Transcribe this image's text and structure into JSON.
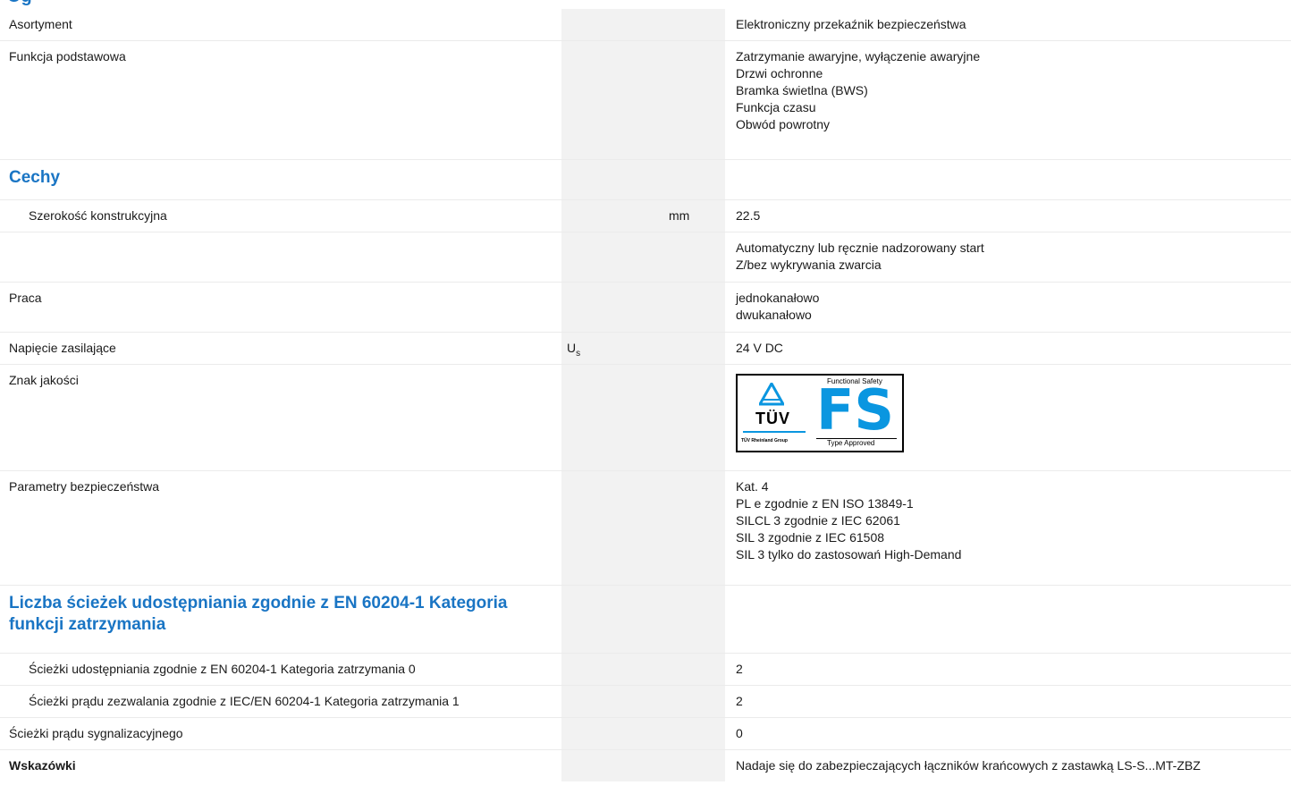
{
  "clipped_heading": "Og",
  "rows": {
    "asortyment": {
      "label": "Asortyment",
      "value": "Elektroniczny przekaźnik bezpieczeństwa"
    },
    "funkcja": {
      "label": "Funkcja podstawowa",
      "values": [
        "Zatrzymanie awaryjne, wyłączenie awaryjne",
        "Drzwi ochronne",
        "Bramka świetlna (BWS)",
        "Funkcja czasu",
        "Obwód powrotny"
      ]
    },
    "cechy_title": "Cechy",
    "szerokosc": {
      "label": "Szerokość konstrukcyjna",
      "unit": "mm",
      "value": "22.5"
    },
    "start": {
      "values": [
        "Automatyczny lub ręcznie nadzorowany start",
        "Z/bez wykrywania zwarcia"
      ]
    },
    "praca": {
      "label": "Praca",
      "values": [
        "jednokanałowo",
        "dwukanałowo"
      ]
    },
    "napiecie": {
      "label": "Napięcie zasilające",
      "symbol": "U",
      "symbol_sub": "s",
      "value": "24 V DC"
    },
    "znak": {
      "label": "Znak jakości",
      "logo": {
        "tuv": "TÜV",
        "tuv_sub": "TÜV Rheinland Group",
        "fs_top": "Functional Safety",
        "fs": "FS",
        "fs_bottom": "Type Approved",
        "brand_color": "#0a96e0"
      }
    },
    "parametry": {
      "label": "Parametry bezpieczeństwa",
      "values": [
        "Kat. 4",
        "PL e zgodnie z EN ISO 13849-1",
        "SILCL 3 zgodnie z IEC 62061",
        "SIL 3 zgodnie z IEC 61508",
        "SIL 3 tylko do zastosowań High-Demand"
      ]
    },
    "liczba_title": "Liczba ścieżek udostępniania zgodnie z EN 60204-1 Kategoria funkcji zatrzymania",
    "sciezki0": {
      "label": "Ścieżki udostępniania zgodnie z EN 60204-1 Kategoria zatrzymania 0",
      "value": "2"
    },
    "sciezki1": {
      "label": "Ścieżki prądu zezwalania zgodnie z IEC/EN 60204-1 Kategoria zatrzymania 1",
      "value": "2"
    },
    "sygnal": {
      "label": "Ścieżki prądu sygnalizacyjnego",
      "value": "0"
    },
    "wskazowki": {
      "label": "Wskazówki",
      "value": "Nadaje się do zabezpieczających łączników krańcowych z zastawką LS-S...MT-ZBZ"
    }
  },
  "colors": {
    "accent": "#1a75c4",
    "shade": "#f2f2f2"
  }
}
